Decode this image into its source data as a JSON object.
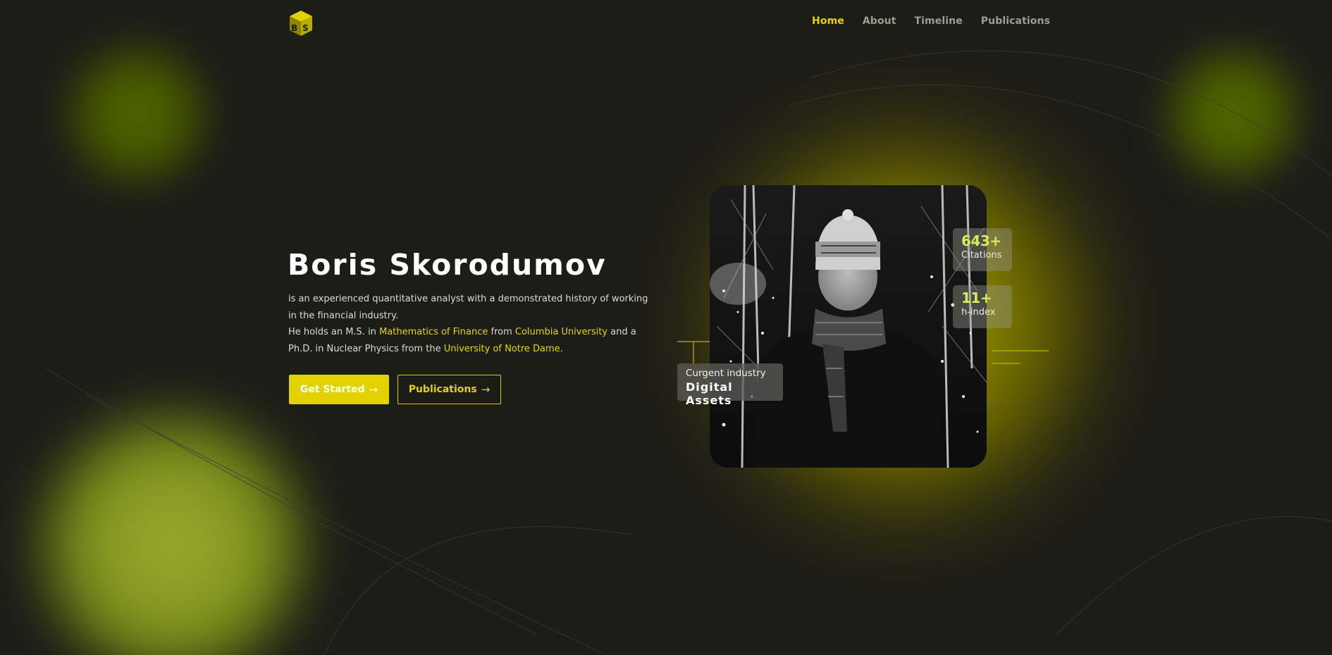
{
  "brand": {
    "logo_icon": "bs-cube-logo-icon",
    "accent": "#e2d300"
  },
  "nav": {
    "items": [
      {
        "label": "Home",
        "active": true
      },
      {
        "label": "About",
        "active": false
      },
      {
        "label": "Timeline",
        "active": false
      },
      {
        "label": "Publications",
        "active": false
      }
    ]
  },
  "hero": {
    "name": "Boris Skorodumov",
    "bio": {
      "line1": "is an experienced quantitative analyst with a demonstrated history of working in the financial industry.",
      "line2_a": "He holds an M.S. in ",
      "line2_link1": "Mathematics of Finance",
      "line2_b": " from ",
      "line2_link2": "Columbia University",
      "line2_c": " and a Ph.D. in Nuclear Physics from the ",
      "line2_link3": "University of Notre Dame",
      "line2_d": "."
    },
    "buttons": {
      "primary_label": "Get Started",
      "secondary_label": "Publications",
      "arrow_icon": "arrow-right-icon"
    }
  },
  "stats": [
    {
      "value": "643",
      "suffix": "+",
      "label": "Citations"
    },
    {
      "value": "11",
      "suffix": "+",
      "label": "h-index"
    }
  ],
  "industry": {
    "caption": "Curgent industry",
    "value": "Digital Assets"
  },
  "colors": {
    "background": "#1d1d18",
    "accent": "#e6d400",
    "stat_number": "#dbe85a"
  }
}
